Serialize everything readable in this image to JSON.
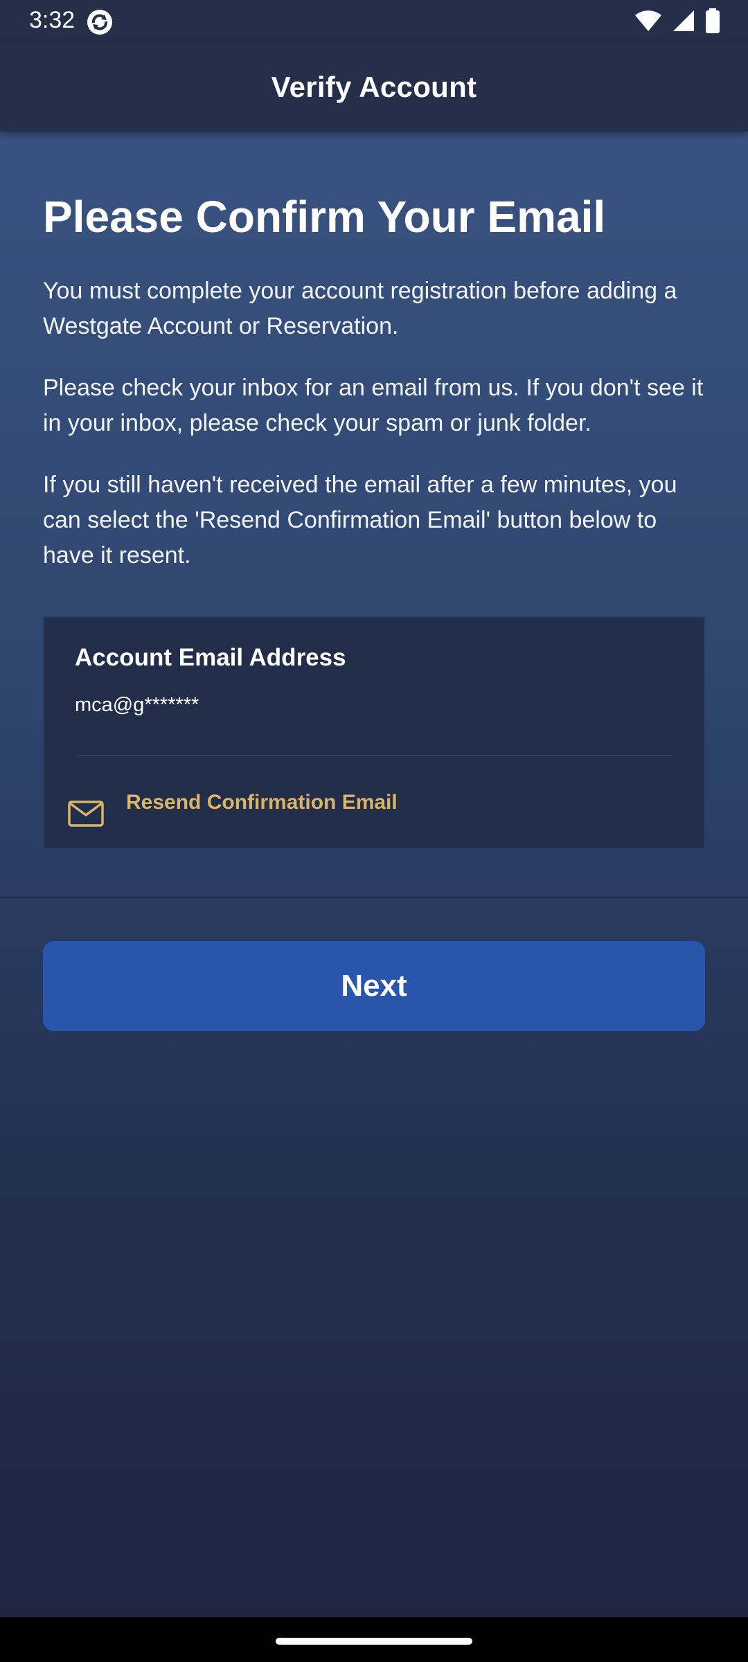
{
  "status_bar": {
    "time": "3:32",
    "icons": [
      "sync-icon",
      "wifi-icon",
      "signal-icon",
      "battery-icon"
    ]
  },
  "app_bar": {
    "title": "Verify Account"
  },
  "main": {
    "heading": "Please Confirm Your Email",
    "paragraphs": [
      "You must complete your account registration before adding a Westgate Account or Reservation.",
      "Please check your inbox for an email from us. If you don't see it in your inbox, please check your spam or junk folder.",
      "If you still haven't received the email after a few minutes, you can select the 'Resend Confirmation Email' button below to have it resent."
    ],
    "email_card": {
      "label": "Account Email Address",
      "value": "mca@g*******",
      "resend_label": "Resend Confirmation Email",
      "resend_icon": "envelope-icon"
    }
  },
  "footer": {
    "next_label": "Next"
  },
  "colors": {
    "app_bar_bg": "#252f49",
    "accent_gold": "#d9b56a",
    "primary_button": "#2955ad",
    "card_bg": "#222d4a"
  }
}
